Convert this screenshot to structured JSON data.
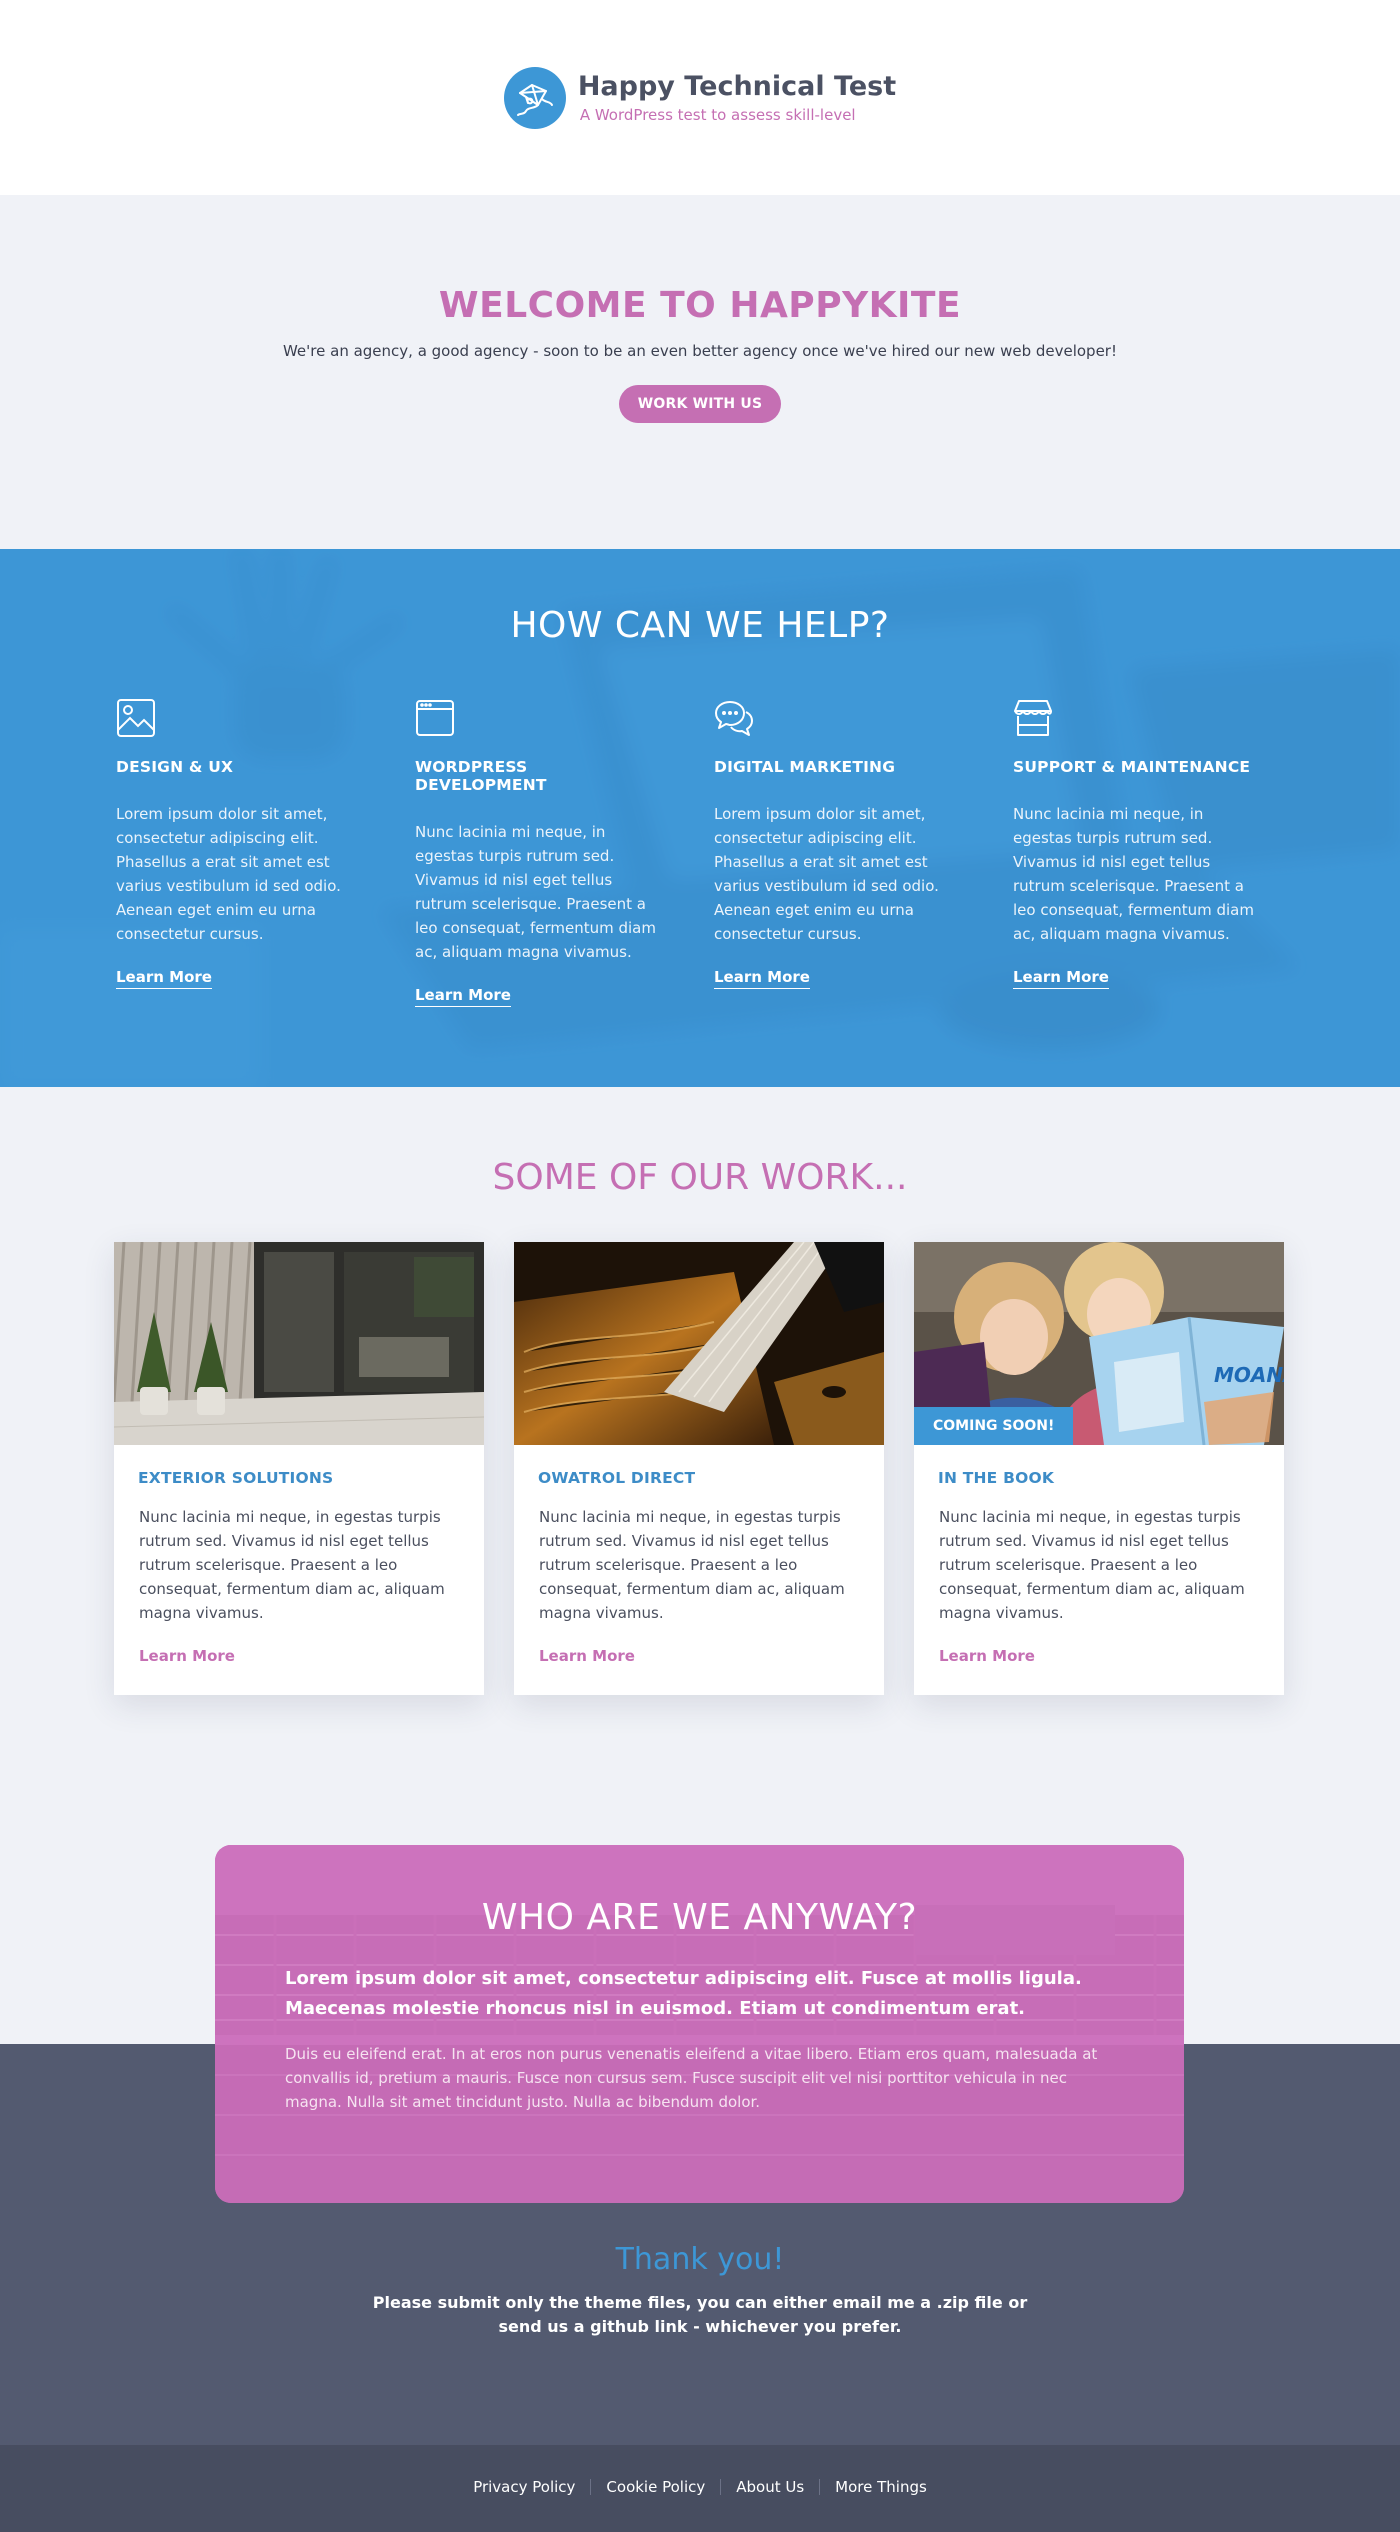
{
  "site": {
    "title": "Happy Technical Test",
    "tagline": "A WordPress test to assess skill-level",
    "logo_icon": "kite-icon"
  },
  "welcome": {
    "title": "WELCOME TO HAPPYKITE",
    "text": "We're an agency, a good agency - soon to be an even better agency once we've hired our new web developer!",
    "button": "WORK WITH US"
  },
  "services": {
    "title": "HOW CAN WE HELP?",
    "items": [
      {
        "icon": "image-icon",
        "title": "DESIGN & UX",
        "text": "Lorem ipsum dolor sit amet, consectetur adipiscing elit. Phasellus a erat sit amet est varius vestibulum id sed odio. Aenean eget enim eu urna consectetur cursus.",
        "link": "Learn More"
      },
      {
        "icon": "browser-window-icon",
        "title": "WORDPRESS DEVELOPMENT",
        "text": "Nunc lacinia mi neque, in egestas turpis rutrum sed. Vivamus id nisl eget tellus rutrum scelerisque. Praesent a leo consequat, fermentum diam ac, aliquam magna vivamus.",
        "link": "Learn More"
      },
      {
        "icon": "chat-bubbles-icon",
        "title": "DIGITAL MARKETING",
        "text": "Lorem ipsum dolor sit amet, consectetur adipiscing elit. Phasellus a erat sit amet est varius vestibulum id sed odio. Aenean eget enim eu urna consectetur cursus.",
        "link": "Learn More"
      },
      {
        "icon": "storefront-icon",
        "title": "SUPPORT & MAINTENANCE",
        "text": "Nunc lacinia mi neque, in egestas turpis rutrum sed. Vivamus id nisl eget tellus rutrum scelerisque. Praesent a leo consequat, fermentum diam ac, aliquam magna vivamus.",
        "link": "Learn More"
      }
    ]
  },
  "work": {
    "title": "SOME OF OUR WORK...",
    "items": [
      {
        "title": "EXTERIOR SOLUTIONS",
        "text": "Nunc lacinia mi neque, in egestas turpis rutrum sed. Vivamus id nisl eget tellus rutrum scelerisque. Praesent a leo consequat, fermentum diam ac, aliquam magna vivamus.",
        "link": "Learn More",
        "badge": ""
      },
      {
        "title": "OWATROL DIRECT",
        "text": "Nunc lacinia mi neque, in egestas turpis rutrum sed. Vivamus id nisl eget tellus rutrum scelerisque. Praesent a leo consequat, fermentum diam ac, aliquam magna vivamus.",
        "link": "Learn More",
        "badge": ""
      },
      {
        "title": "IN THE BOOK",
        "text": "Nunc lacinia mi neque, in egestas turpis rutrum sed. Vivamus id nisl eget tellus rutrum scelerisque. Praesent a leo consequat, fermentum diam ac, aliquam magna vivamus.",
        "link": "Learn More",
        "badge": "COMING SOON!",
        "book_logo": "MOANA"
      }
    ]
  },
  "about": {
    "title": "WHO ARE WE ANYWAY?",
    "lead": "Lorem ipsum dolor sit amet, consectetur adipiscing elit. Fusce at mollis ligula. Maecenas molestie rhoncus nisl in euismod. Etiam ut condimentum erat.",
    "text": "Duis eu eleifend erat. In at eros non purus venenatis eleifend a vitae libero. Etiam eros quam, malesuada at convallis id, pretium a mauris. Fusce non cursus sem. Fusce suscipit elit vel nisi porttitor vehicula in nec magna. Nulla sit amet tincidunt justo. Nulla ac bibendum dolor."
  },
  "thanks": {
    "title": "Thank you!",
    "line1": "Please submit only the theme files, you can either email me a .zip file or",
    "line2": "send us a github link - whichever you prefer."
  },
  "footer": {
    "links": [
      "Privacy Policy",
      "Cookie Policy",
      "About Us",
      "More Things"
    ]
  },
  "colors": {
    "brand_pink": "#c56fb3",
    "brand_blue": "#3d97d6",
    "dark_slate": "#535a70",
    "footer": "#474d60",
    "page_bg": "#f0f2f7"
  }
}
